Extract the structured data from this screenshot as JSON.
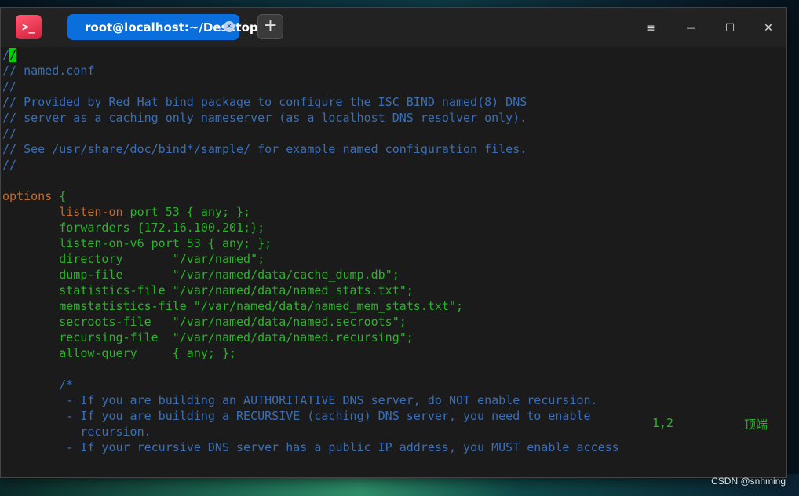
{
  "tab": {
    "title": "root@localhost:~/Desktop",
    "close_glyph": "×"
  },
  "titlebar": {
    "app_icon_glyph": ">_",
    "new_tab_glyph": "+",
    "menu_glyph": "≡",
    "minimize_glyph": "—",
    "maximize_glyph": "☐",
    "close_glyph": "✕"
  },
  "editor": {
    "lines": [
      {
        "type": "cursorline",
        "text": "/",
        "cursor": "/"
      },
      {
        "type": "comment",
        "text": "// named.conf"
      },
      {
        "type": "comment",
        "text": "//"
      },
      {
        "type": "comment",
        "text": "// Provided by Red Hat bind package to configure the ISC BIND named(8) DNS"
      },
      {
        "type": "comment",
        "text": "// server as a caching only nameserver (as a localhost DNS resolver only)."
      },
      {
        "type": "comment",
        "text": "//"
      },
      {
        "type": "comment",
        "text": "// See /usr/share/doc/bind*/sample/ for example named configuration files."
      },
      {
        "type": "comment",
        "text": "//"
      },
      {
        "type": "blank",
        "text": ""
      },
      {
        "type": "options",
        "kw": "options",
        "rest": " {"
      },
      {
        "type": "listen",
        "indent": "        ",
        "kw": "listen-on",
        "rest": " port 53 { any; };"
      },
      {
        "type": "code",
        "text": "        forwarders {172.16.100.201;};"
      },
      {
        "type": "code",
        "text": "        listen-on-v6 port 53 { any; };"
      },
      {
        "type": "code",
        "text": "        directory       \"/var/named\";"
      },
      {
        "type": "code",
        "text": "        dump-file       \"/var/named/data/cache_dump.db\";"
      },
      {
        "type": "code",
        "text": "        statistics-file \"/var/named/data/named_stats.txt\";"
      },
      {
        "type": "code",
        "text": "        memstatistics-file \"/var/named/data/named_mem_stats.txt\";"
      },
      {
        "type": "code",
        "text": "        secroots-file   \"/var/named/data/named.secroots\";"
      },
      {
        "type": "code",
        "text": "        recursing-file  \"/var/named/data/named.recursing\";"
      },
      {
        "type": "code",
        "text": "        allow-query     { any; };"
      },
      {
        "type": "blank",
        "text": ""
      },
      {
        "type": "comment",
        "text": "        /*"
      },
      {
        "type": "comment",
        "text": "         - If you are building an AUTHORITATIVE DNS server, do NOT enable recursion."
      },
      {
        "type": "comment",
        "text": "         - If you are building a RECURSIVE (caching) DNS server, you need to enable"
      },
      {
        "type": "comment",
        "text": "           recursion."
      },
      {
        "type": "comment",
        "text": "         - If your recursive DNS server has a public IP address, you MUST enable access"
      }
    ],
    "status_position": "1,2",
    "status_top": "顶端"
  },
  "watermark": "CSDN @snhming",
  "colors": {
    "comment": "#3a6fb8",
    "keyword": "#c36c2d",
    "text": "#2ab52a",
    "tab": "#0a6fdc",
    "cursor": "#00d000"
  }
}
